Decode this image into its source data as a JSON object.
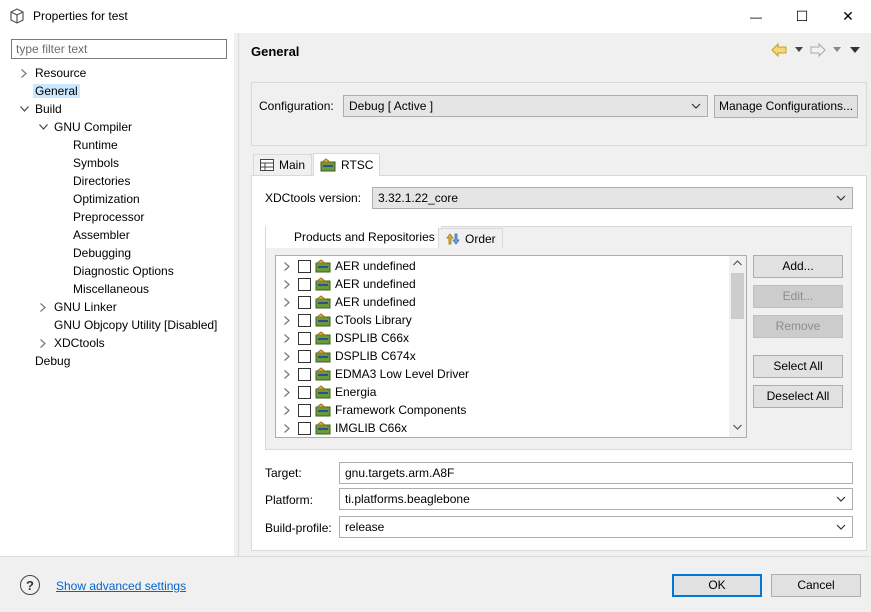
{
  "window": {
    "title": "Properties for test",
    "minimize_glyph": "—",
    "maximize_glyph": "☐",
    "close_glyph": "✕"
  },
  "filter": {
    "placeholder": "type filter text",
    "value": ""
  },
  "tree": [
    {
      "label": "Resource",
      "indent": 0,
      "chevron": "collapsed"
    },
    {
      "label": "General",
      "indent": 0,
      "chevron": "none",
      "selected": true
    },
    {
      "label": "Build",
      "indent": 0,
      "chevron": "expanded"
    },
    {
      "label": "GNU Compiler",
      "indent": 1,
      "chevron": "expanded"
    },
    {
      "label": "Runtime",
      "indent": 2,
      "chevron": "none"
    },
    {
      "label": "Symbols",
      "indent": 2,
      "chevron": "none"
    },
    {
      "label": "Directories",
      "indent": 2,
      "chevron": "none"
    },
    {
      "label": "Optimization",
      "indent": 2,
      "chevron": "none"
    },
    {
      "label": "Preprocessor",
      "indent": 2,
      "chevron": "none"
    },
    {
      "label": "Assembler",
      "indent": 2,
      "chevron": "none"
    },
    {
      "label": "Debugging",
      "indent": 2,
      "chevron": "none"
    },
    {
      "label": "Diagnostic Options",
      "indent": 2,
      "chevron": "none"
    },
    {
      "label": "Miscellaneous",
      "indent": 2,
      "chevron": "none"
    },
    {
      "label": "GNU Linker",
      "indent": 1,
      "chevron": "collapsed"
    },
    {
      "label": "GNU Objcopy Utility  [Disabled]",
      "indent": 1,
      "chevron": "none"
    },
    {
      "label": "XDCtools",
      "indent": 1,
      "chevron": "collapsed"
    },
    {
      "label": "Debug",
      "indent": 0,
      "chevron": "none"
    }
  ],
  "page": {
    "title": "General",
    "configuration_label": "Configuration:",
    "configuration_value": "Debug  [ Active ]",
    "manage_button": "Manage Configurations..."
  },
  "tabs": [
    {
      "label": "Main",
      "icon": "table-icon",
      "active": false
    },
    {
      "label": "RTSC",
      "icon": "rtsc-icon",
      "active": true
    }
  ],
  "rtsc": {
    "xdctools_label": "XDCtools version:",
    "xdctools_value": "3.32.1.22_core",
    "subtabs": [
      {
        "label": "Products and Repositories",
        "active": true
      },
      {
        "label": "Order",
        "active": false
      }
    ],
    "products": [
      "AER undefined",
      "AER undefined",
      "AER undefined",
      "CTools Library",
      "DSPLIB C66x",
      "DSPLIB C674x",
      "EDMA3 Low Level Driver",
      "Energia",
      "Framework Components",
      "IMGLIB C66x"
    ],
    "buttons": {
      "add": "Add...",
      "edit": "Edit...",
      "remove": "Remove",
      "select_all": "Select All",
      "deselect_all": "Deselect All"
    },
    "target_label": "Target:",
    "target_value": "gnu.targets.arm.A8F",
    "platform_label": "Platform:",
    "platform_value": "ti.platforms.beaglebone",
    "build_profile_label": "Build-profile:",
    "build_profile_value": "release"
  },
  "footer": {
    "help_glyph": "?",
    "advanced_link": "Show advanced settings",
    "ok": "OK",
    "cancel": "Cancel"
  },
  "colors": {
    "selection": "#cce8ff",
    "link": "#0066cc",
    "primary_border": "#0078d7",
    "nav_arrow": "#e8b53a"
  }
}
